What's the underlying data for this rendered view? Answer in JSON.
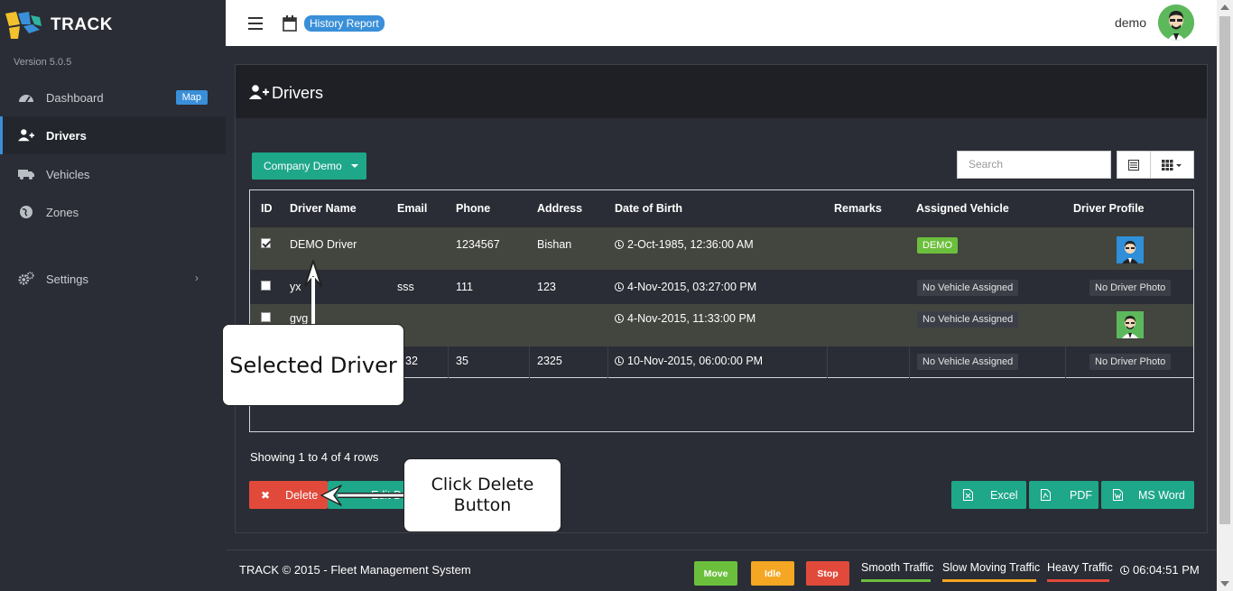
{
  "app": {
    "brand": "TRACK",
    "version": "Version 5.0.5"
  },
  "sidebar": {
    "items": [
      {
        "label": "Dashboard",
        "badge": "Map",
        "icon": "dashboard-icon"
      },
      {
        "label": "Drivers",
        "icon": "add-user-icon",
        "active": true
      },
      {
        "label": "Vehicles",
        "icon": "truck-icon"
      },
      {
        "label": "Zones",
        "icon": "globe-icon"
      },
      {
        "label": "Settings",
        "icon": "gears-icon",
        "chevron": "›"
      }
    ]
  },
  "header": {
    "history_badge": "History Report",
    "user": "demo"
  },
  "panel": {
    "title": "Drivers",
    "company_button": "Company Demo",
    "search_placeholder": "Search"
  },
  "table": {
    "columns": [
      "ID",
      "Driver Name",
      "Email",
      "Phone",
      "Address",
      "Date of Birth",
      "Remarks",
      "Assigned Vehicle",
      "Driver Profile"
    ],
    "rows": [
      {
        "checked": true,
        "name": "DEMO Driver",
        "email": "",
        "phone": "1234567",
        "address": "Bishan",
        "dob": "2-Oct-1985, 12:36:00 AM",
        "remarks": "",
        "vehicle": "DEMO",
        "vehicle_style": "green",
        "profile": "photo"
      },
      {
        "checked": false,
        "name": "yx",
        "email": "sss",
        "phone": "111",
        "address": "123",
        "dob": "4-Nov-2015, 03:27:00 PM",
        "remarks": "",
        "vehicle": "No Vehicle Assigned",
        "vehicle_style": "gray",
        "profile": "No Driver Photo"
      },
      {
        "checked": false,
        "name": "gvg",
        "email": "",
        "phone": "",
        "address": "",
        "dob": "4-Nov-2015, 11:33:00 PM",
        "remarks": "",
        "vehicle": "No Vehicle Assigned",
        "vehicle_style": "gray",
        "profile": "photo"
      },
      {
        "checked": false,
        "name": "",
        "email": "32",
        "phone": "35",
        "address": "2325",
        "dob": "10-Nov-2015, 06:00:00 PM",
        "remarks": "",
        "vehicle": "No Vehicle Assigned",
        "vehicle_style": "gray",
        "profile": "No Driver Photo"
      }
    ],
    "showing": "Showing 1 to 4 of 4 rows"
  },
  "actions": {
    "delete": "Delete",
    "edit": "Edit D",
    "excel": "Excel",
    "pdf": "PDF",
    "word": "MS Word"
  },
  "callouts": {
    "selected": "Selected Driver",
    "delete_line1": "Click Delete",
    "delete_line2": "Button"
  },
  "footer": {
    "copyright": "TRACK © 2015 - Fleet Management System",
    "move": "Move",
    "idle": "Idle",
    "stop": "Stop",
    "smooth": "Smooth Traffic",
    "slow": "Slow Moving Traffic",
    "heavy": "Heavy Traffic",
    "time": "06:04:51 PM"
  },
  "colors": {
    "accent_blue": "#3a8fd8",
    "teal": "#1fa78a",
    "danger": "#e14a3b",
    "move": "#6cbf3c",
    "idle": "#f5a623",
    "stop": "#e14a3b",
    "smooth_line": "#6cbf3c",
    "slow_line": "#f5a623",
    "heavy_line": "#e14a3b"
  }
}
